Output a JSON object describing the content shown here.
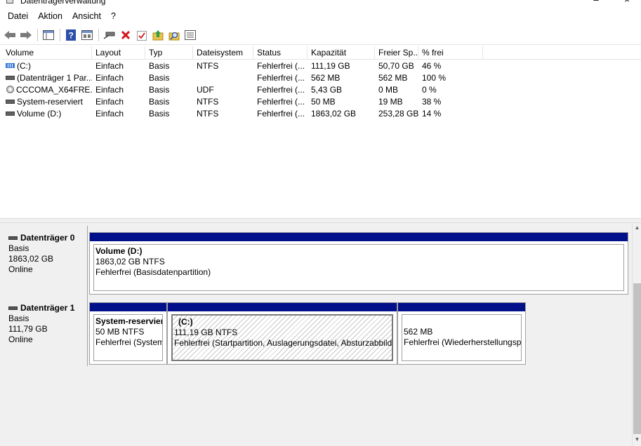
{
  "window": {
    "title": "Datenträgerverwaltung"
  },
  "menu": [
    "Datei",
    "Aktion",
    "Ansicht",
    "?"
  ],
  "toolbar": [
    "back-icon",
    "forward-icon",
    "console-tree-icon",
    "help-icon",
    "properties-icon",
    "connect-drive-icon",
    "delete-icon",
    "checklist-icon",
    "up-icon",
    "find-icon",
    "details-icon"
  ],
  "volume_list": {
    "columns": [
      "Volume",
      "Layout",
      "Typ",
      "Dateisystem",
      "Status",
      "Kapazität",
      "Freier Sp...",
      "% frei"
    ],
    "rows": [
      {
        "icon": "volume-striped-icon",
        "cells": [
          "(C:)",
          "Einfach",
          "Basis",
          "NTFS",
          "Fehlerfrei (...",
          "111,19 GB",
          "50,70 GB",
          "46 %"
        ]
      },
      {
        "icon": "volume-icon",
        "cells": [
          "(Datenträger 1 Par...",
          "Einfach",
          "Basis",
          "",
          "Fehlerfrei (...",
          "562 MB",
          "562 MB",
          "100 %"
        ]
      },
      {
        "icon": "cd-icon",
        "cells": [
          "CCCOMA_X64FRE...",
          "Einfach",
          "Basis",
          "UDF",
          "Fehlerfrei (...",
          "5,43 GB",
          "0 MB",
          "0 %"
        ]
      },
      {
        "icon": "volume-icon",
        "cells": [
          "System-reserviert",
          "Einfach",
          "Basis",
          "NTFS",
          "Fehlerfrei (...",
          "50 MB",
          "19 MB",
          "38 %"
        ]
      },
      {
        "icon": "volume-icon",
        "cells": [
          "Volume (D:)",
          "Einfach",
          "Basis",
          "NTFS",
          "Fehlerfrei (...",
          "1863,02 GB",
          "253,28 GB",
          "14 %"
        ]
      }
    ]
  },
  "disks": [
    {
      "name": "Datenträger 0",
      "type": "Basis",
      "size": "1863,02 GB",
      "state": "Online",
      "partitions": [
        {
          "title": "Volume  (D:)",
          "line2": "1863,02 GB NTFS",
          "line3": "Fehlerfrei (Basisdatenpartition)"
        }
      ]
    },
    {
      "name": "Datenträger 1",
      "type": "Basis",
      "size": "111,79 GB",
      "state": "Online",
      "partitions": [
        {
          "title": "System-reservier",
          "line2": "50 MB NTFS",
          "line3": "Fehlerfrei (System,"
        },
        {
          "title": "(C:)",
          "line2": "111,19 GB NTFS",
          "line3": "Fehlerfrei (Startpartition, Auslagerungsdatei, Absturzabbild,"
        },
        {
          "title": "",
          "line2": "562 MB",
          "line3": "Fehlerfrei (Wiederherstellungsp"
        }
      ]
    }
  ],
  "colors": {
    "partition_header": "#000f8a",
    "panel_bg": "#f0f0f0"
  }
}
